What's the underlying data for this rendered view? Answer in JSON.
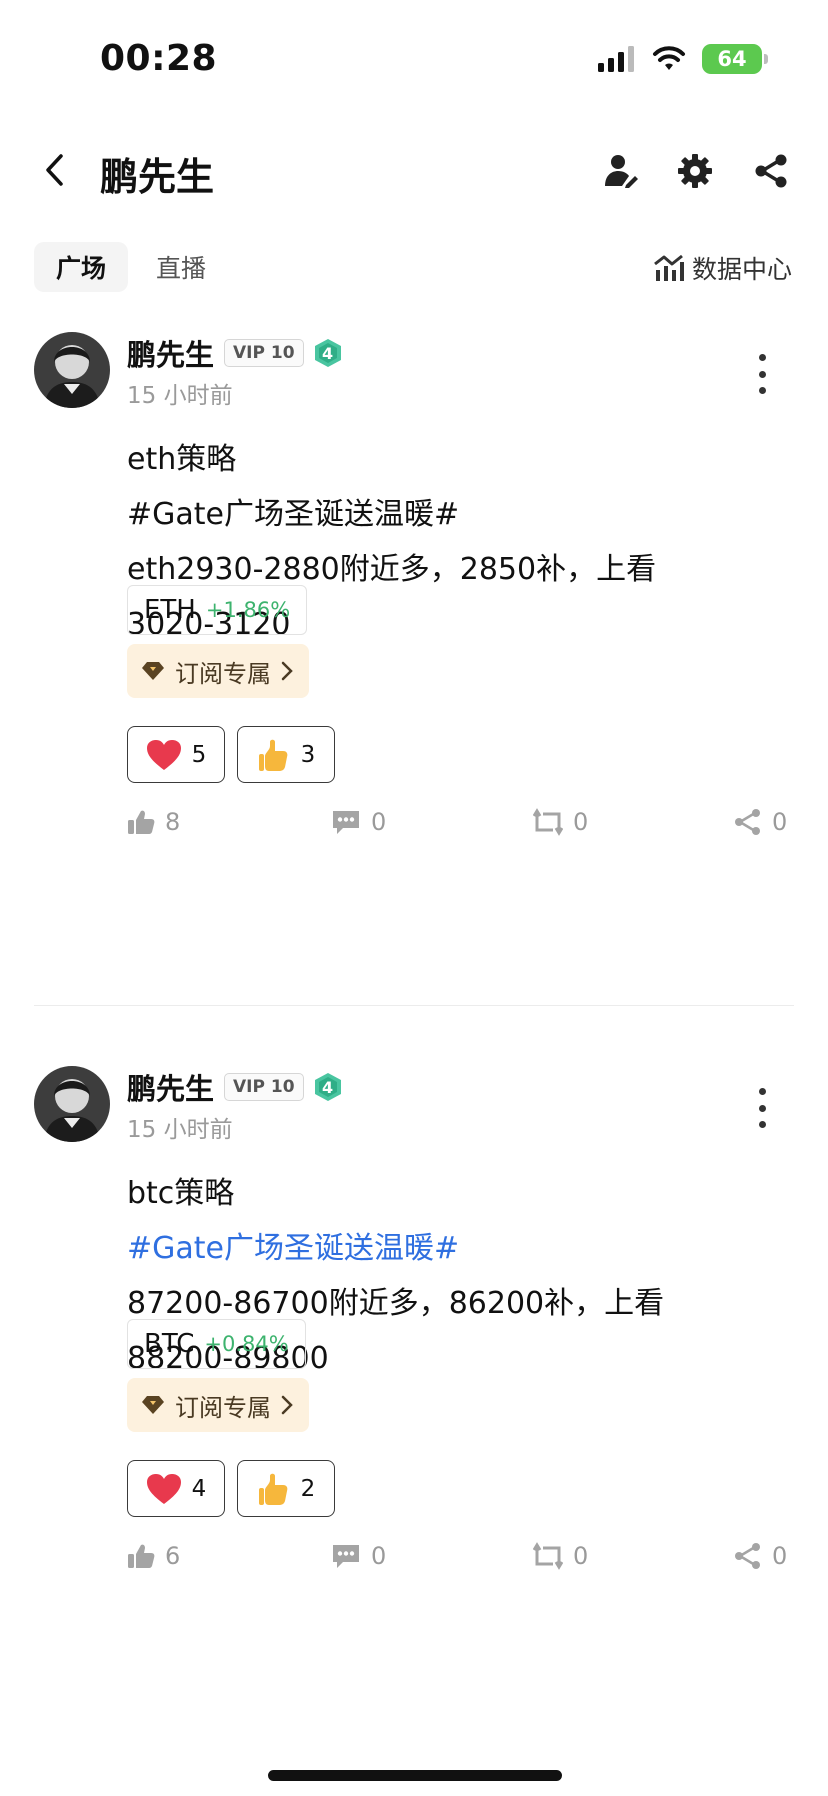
{
  "status": {
    "time": "00:28",
    "battery": "64"
  },
  "nav": {
    "title": "鹏先生"
  },
  "tabs": [
    {
      "label": "广场"
    },
    {
      "label": "直播"
    }
  ],
  "data_center": {
    "label": "数据中心"
  },
  "posts": [
    {
      "author": "鹏先生",
      "vip": "VIP 10",
      "level": "4",
      "time": "15 小时前",
      "lines": [
        "eth策略",
        "#Gate广场圣诞送温暖#",
        "eth2930-2880附近多，2850补，上看",
        "3020-3120"
      ],
      "coin": {
        "symbol": "ETH",
        "change": "+1.86%"
      },
      "subscribe": "订阅专属",
      "reactions": [
        {
          "icon": "heart",
          "count": "5"
        },
        {
          "icon": "thumb",
          "count": "3"
        }
      ],
      "actions": {
        "like": "8",
        "comment": "0",
        "repost": "0",
        "share": "0"
      }
    },
    {
      "author": "鹏先生",
      "vip": "VIP 10",
      "level": "4",
      "time": "15 小时前",
      "lines": [
        "btc策略",
        "#Gate广场圣诞送温暖#",
        "87200-86700附近多，86200补，上看",
        "88200-89800"
      ],
      "coin": {
        "symbol": "BTC",
        "change": "+0.84%"
      },
      "subscribe": "订阅专属",
      "reactions": [
        {
          "icon": "heart",
          "count": "4"
        },
        {
          "icon": "thumb",
          "count": "2"
        }
      ],
      "actions": {
        "like": "6",
        "comment": "0",
        "repost": "0",
        "share": "0"
      }
    }
  ]
}
